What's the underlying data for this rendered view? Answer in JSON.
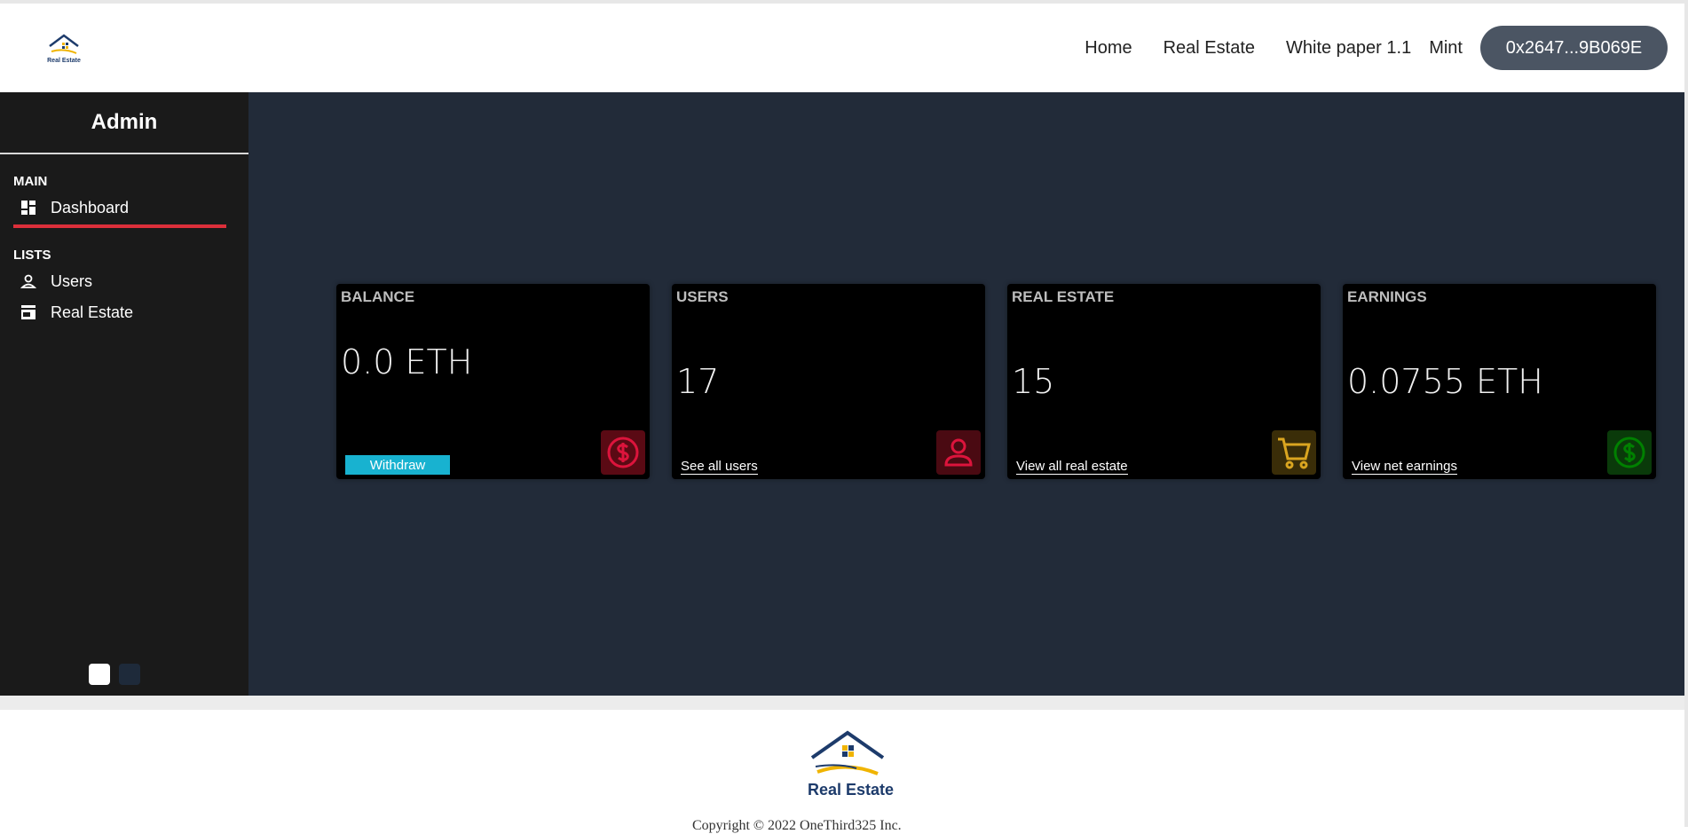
{
  "navbar": {
    "links": [
      "Home",
      "Real Estate",
      "White paper 1.1",
      "Mint"
    ],
    "wallet_address": "0x2647...9B069E"
  },
  "sidebar": {
    "title": "Admin",
    "sections": [
      {
        "heading": "MAIN",
        "items": [
          {
            "label": "Dashboard",
            "icon": "dashboard-icon",
            "active": true
          }
        ]
      },
      {
        "heading": "LISTS",
        "items": [
          {
            "label": "Users",
            "icon": "user-icon"
          },
          {
            "label": "Real Estate",
            "icon": "store-icon"
          }
        ]
      }
    ]
  },
  "cards": [
    {
      "title": "BALANCE",
      "value": "0.0 ETH",
      "action": "Withdraw",
      "icon": "dollar-circle-icon",
      "color": "#dc143c"
    },
    {
      "title": "USERS",
      "value": "17",
      "action": "See all users",
      "icon": "person-icon",
      "color": "#dc143c"
    },
    {
      "title": "REAL ESTATE",
      "value": "15",
      "action": "View all real estate",
      "icon": "cart-icon",
      "color": "#daa520"
    },
    {
      "title": "EARNINGS",
      "value": "0.0755 ETH",
      "action": "View net earnings",
      "icon": "dollar-circle-icon",
      "color": "#008000"
    }
  ],
  "footer": {
    "brand": "Real Estate",
    "copyright": "Copyright © 2022 OneThird325 Inc."
  },
  "colors": {
    "accent": "#dc2f3a",
    "main_bg": "#222b39",
    "sidebar_bg": "#1a1a1a",
    "withdraw": "#18b2d0"
  }
}
